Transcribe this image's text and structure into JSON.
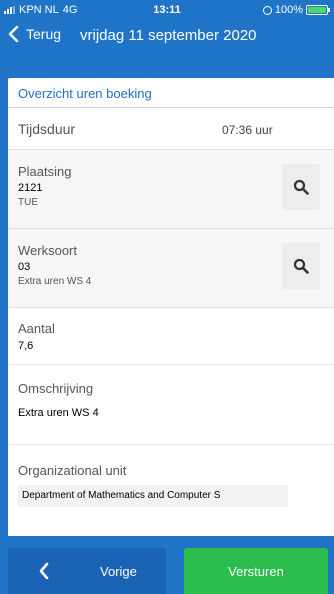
{
  "status_bar": {
    "carrier": "KPN NL",
    "network": "4G",
    "time": "13:11",
    "battery": "100%",
    "battery_level": 1.0
  },
  "nav": {
    "back_label": "Terug",
    "title": "vrijdag 11 september 2020"
  },
  "section": {
    "title": "Overzicht uren boeking"
  },
  "fields": {
    "duration": {
      "label": "Tijdsduur",
      "value": "07:36 uur"
    },
    "placement": {
      "label": "Plaatsing",
      "code": "2121",
      "desc": "TUE"
    },
    "work_type": {
      "label": "Werksoort",
      "code": "03",
      "desc": "Extra uren WS 4"
    },
    "amount": {
      "label": "Aantal",
      "value": "7,6"
    },
    "description": {
      "label": "Omschrijving",
      "value": "Extra uren WS 4"
    },
    "org_unit": {
      "label": "Organizational unit",
      "value": "Department of Mathematics and Computer S"
    }
  },
  "buttons": {
    "previous": "Vorige",
    "send": "Versturen"
  },
  "colors": {
    "brand_blue": "#1f74c8",
    "button_blue": "#1b63b4",
    "send_green": "#2bbd4e",
    "section_title": "#1f6fbf"
  },
  "icons": {
    "back": "chevron-left-icon",
    "search": "search-icon",
    "previous": "chevron-left-icon"
  }
}
